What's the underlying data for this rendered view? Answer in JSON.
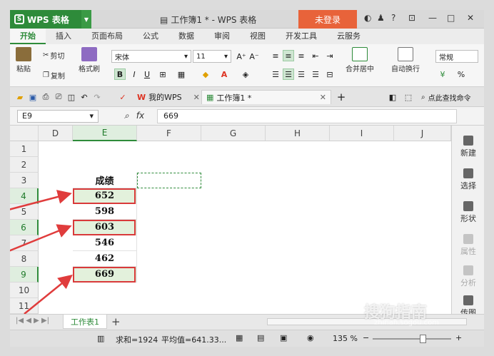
{
  "app": {
    "logo": "WPS 表格",
    "title": "工作簿1 * - WPS 表格",
    "login": "未登录",
    "help": "?"
  },
  "menu": [
    "开始",
    "插入",
    "页面布局",
    "公式",
    "数据",
    "审阅",
    "视图",
    "开发工具",
    "云服务"
  ],
  "ribbon": {
    "paste": "粘贴",
    "cut": "剪切",
    "copy": "复制",
    "format_painter": "格式刷",
    "font_name": "宋体",
    "font_size": "11",
    "bold": "B",
    "italic": "I",
    "underline": "U",
    "merge_center": "合并居中",
    "wrap_text": "自动换行",
    "number_format": "常规",
    "percent": "%"
  },
  "docbar": {
    "my_wps": "我的WPS",
    "workbook": "工作簿1 *",
    "add": "+",
    "search": "点此查找命令"
  },
  "formula": {
    "name_box": "E9",
    "fx": "fx",
    "value": "669"
  },
  "grid": {
    "columns": [
      "D",
      "E",
      "F",
      "G",
      "H",
      "I",
      "J"
    ],
    "rows": [
      "1",
      "2",
      "3",
      "4",
      "5",
      "6",
      "7",
      "8",
      "9",
      "10",
      "11"
    ],
    "header_cell": "成绩",
    "values": [
      "652",
      "598",
      "603",
      "546",
      "462",
      "669"
    ]
  },
  "side_panel": [
    "新建",
    "选择",
    "形状",
    "属性",
    "分析",
    "传图"
  ],
  "sheets": {
    "active": "工作表1",
    "add": "+"
  },
  "status": {
    "sum": "求和=1924",
    "avg": "平均值=641.33...",
    "zoom": "135 %"
  },
  "watermark": {
    "main": "搜狗指南",
    "sub": "zhinan.sogou.com"
  },
  "colors": {
    "accent": "#2e8b3a",
    "login": "#e8633a",
    "highlight_row": "#e3f1dc",
    "box": "#d93a3a"
  }
}
